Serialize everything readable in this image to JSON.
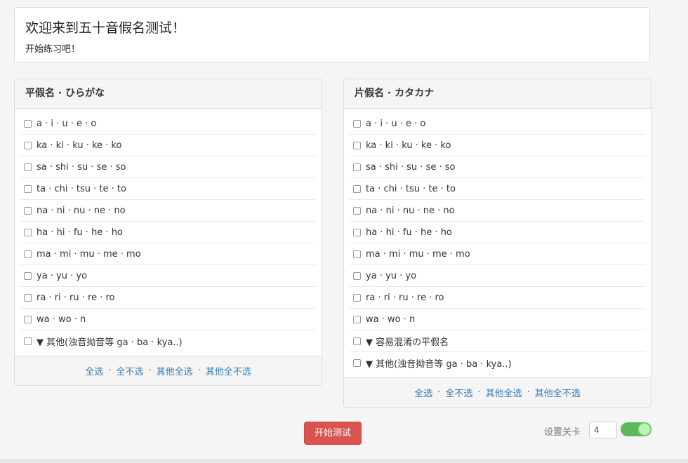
{
  "welcome": {
    "title": "欢迎来到五十音假名测试！",
    "subtitle": "开始练习吧！"
  },
  "hiragana": {
    "title": "平假名 · ひらがな",
    "rows": [
      "a · i · u · e · o",
      "ka · ki · ku · ke · ko",
      "sa · shi · su · se · so",
      "ta · chi · tsu · te · to",
      "na · ni · nu · ne · no",
      "ha · hi · fu · he · ho",
      "ma · mi · mu · me · mo",
      "ya · yu · yo",
      "ra · ri · ru · re · ro",
      "wa · wo · n",
      "▼ 其他(浊音拗音等 ga · ba · kya..)"
    ],
    "footer": {
      "select_all": "全选",
      "select_none": "全不选",
      "others_all": "其他全选",
      "others_none": "其他全不选"
    }
  },
  "katakana": {
    "title": "片假名 · カタカナ",
    "rows": [
      "a · i · u · e · o",
      "ka · ki · ku · ke · ko",
      "sa · shi · su · se · so",
      "ta · chi · tsu · te · to",
      "na · ni · nu · ne · no",
      "ha · hi · fu · he · ho",
      "ma · mi · mu · me · mo",
      "ya · yu · yo",
      "ra · ri · ru · re · ro",
      "wa · wo · n",
      "▼ 容易混淆の平假名",
      "▼ 其他(浊音拗音等 ga · ba · kya..)"
    ],
    "footer": {
      "select_all": "全选",
      "select_none": "全不选",
      "others_all": "其他全选",
      "others_none": "其他全不选"
    }
  },
  "controls": {
    "start_button": "开始测试",
    "level_label": "设置关卡",
    "level_value": "4",
    "toggle_on": true,
    "button_color": "#d9534f",
    "toggle_color": "#5cb85c"
  }
}
